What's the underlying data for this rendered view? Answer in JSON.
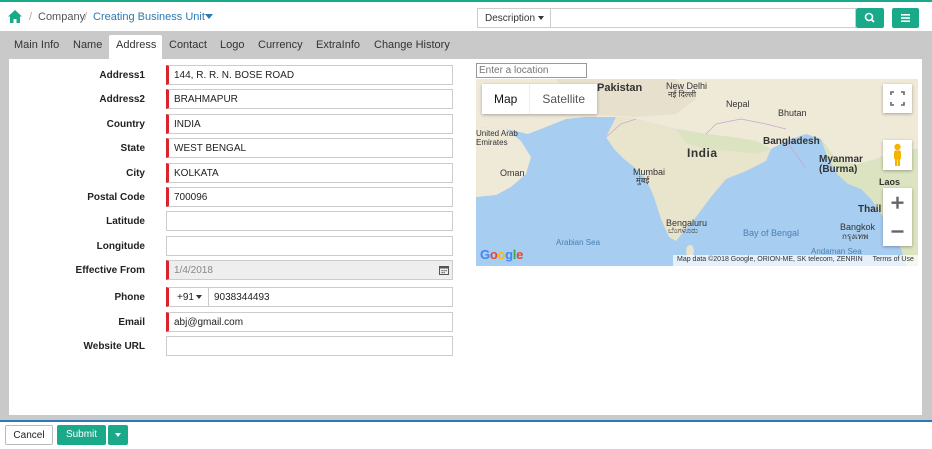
{
  "breadcrumb": {
    "home_icon": "home-icon",
    "items": [
      "Company",
      "Creating Business Unit"
    ]
  },
  "search": {
    "scope": "Description",
    "value": "",
    "search_icon": "search-icon",
    "menu_icon": "hamburger-icon"
  },
  "tabs": [
    "Main Info",
    "Name",
    "Address",
    "Contact",
    "Logo",
    "Currency",
    "ExtraInfo",
    "Change History"
  ],
  "active_tab": "Address",
  "form": {
    "address1": {
      "label": "Address1",
      "value": "144, R. R. N. BOSE ROAD"
    },
    "address2": {
      "label": "Address2",
      "value": "BRAHMAPUR"
    },
    "country": {
      "label": "Country",
      "value": "INDIA"
    },
    "state": {
      "label": "State",
      "value": "WEST BENGAL"
    },
    "city": {
      "label": "City",
      "value": "KOLKATA"
    },
    "postal_code": {
      "label": "Postal Code",
      "value": "700096"
    },
    "latitude": {
      "label": "Latitude",
      "value": ""
    },
    "longitude": {
      "label": "Longitude",
      "value": ""
    },
    "effective_from": {
      "label": "Effective From",
      "value": "1/4/2018",
      "icon": "calendar-icon"
    },
    "phone": {
      "label": "Phone",
      "code": "+91",
      "value": "9038344493"
    },
    "email": {
      "label": "Email",
      "value": "abj@gmail.com"
    },
    "website": {
      "label": "Website URL",
      "value": ""
    }
  },
  "map": {
    "location_placeholder": "Enter a location",
    "type_map": "Map",
    "type_satellite": "Satellite",
    "labels": {
      "pakistan": "Pakistan",
      "new_delhi": "New Delhi",
      "new_delhi_hindi": "नई दिल्ली",
      "nepal": "Nepal",
      "bhutan": "Bhutan",
      "uae": "United Arab Emirates",
      "india": "India",
      "bangladesh": "Bangladesh",
      "myanmar": "Myanmar (Burma)",
      "oman": "Oman",
      "mumbai": "Mumbai",
      "mumbai_hindi": "मुंबई",
      "laos": "Laos",
      "thailand": "Thail",
      "bengaluru": "Bengaluru",
      "bengaluru_kannada": "ಬೆಂಗಳೂರು",
      "bay_of_bengal": "Bay of Bengal",
      "bangkok": "Bangkok",
      "bangkok_thai": "กรุงเทพ",
      "arabian_sea": "Arabian Sea",
      "andaman_sea": "Andaman Sea"
    },
    "attribution": "Map data ©2018 Google, ORION-ME, SK telecom, ZENRIN",
    "terms": "Terms of Use",
    "logo": "Google"
  },
  "footer": {
    "cancel": "Cancel",
    "submit": "Submit"
  },
  "colors": {
    "accent": "#1aaa8a",
    "link": "#2a7ab5",
    "required": "#d9232d"
  }
}
